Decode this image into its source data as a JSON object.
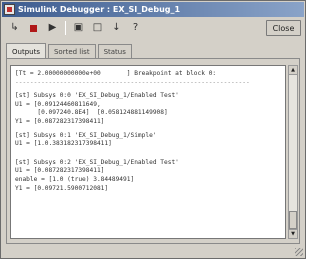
{
  "window": {
    "title": "Simulink Debugger : EX_SI_Debug_1"
  },
  "toolbar": {
    "step_icon": "step-over-icon",
    "stop_icon": "stop-icon",
    "run_icon": "run-icon",
    "close_label": "Close"
  },
  "tabs": [
    {
      "label": "Outputs",
      "active": true
    },
    {
      "label": "Sorted list",
      "active": false
    },
    {
      "label": "Status",
      "active": false
    }
  ],
  "output_lines": [
    "[Tt = 2.00000000000e+00       ] Breakpoint at block 0:",
    "---------------------------------------------------------------",
    "",
    "[st] Subsys 0:0 'EX_SI_Debug_1/Enabled Test'",
    "U1 = [0.09124460811649,",
    "      [0.097240.8E4]  [0.058124881149908]",
    "Y1 = [0.087282317398411]",
    "",
    "[st] Subsys 0:1 'EX_SI_Debug_1/Simple'",
    "U1 = [1.0.383182317398411]",
    "",
    "",
    "[st] Subsys 0:2 'EX_SI_Debug_1/Enabled Test'",
    "U1 = [0.087282317398411]",
    "enable = [1.0 (true) 3.84489491]",
    "Y1 = [0.09721.5900712081]"
  ],
  "colors": {
    "titlebar_start": "#3d5c8f",
    "titlebar_end": "#8aa3c8",
    "stop_red": "#b01818"
  }
}
